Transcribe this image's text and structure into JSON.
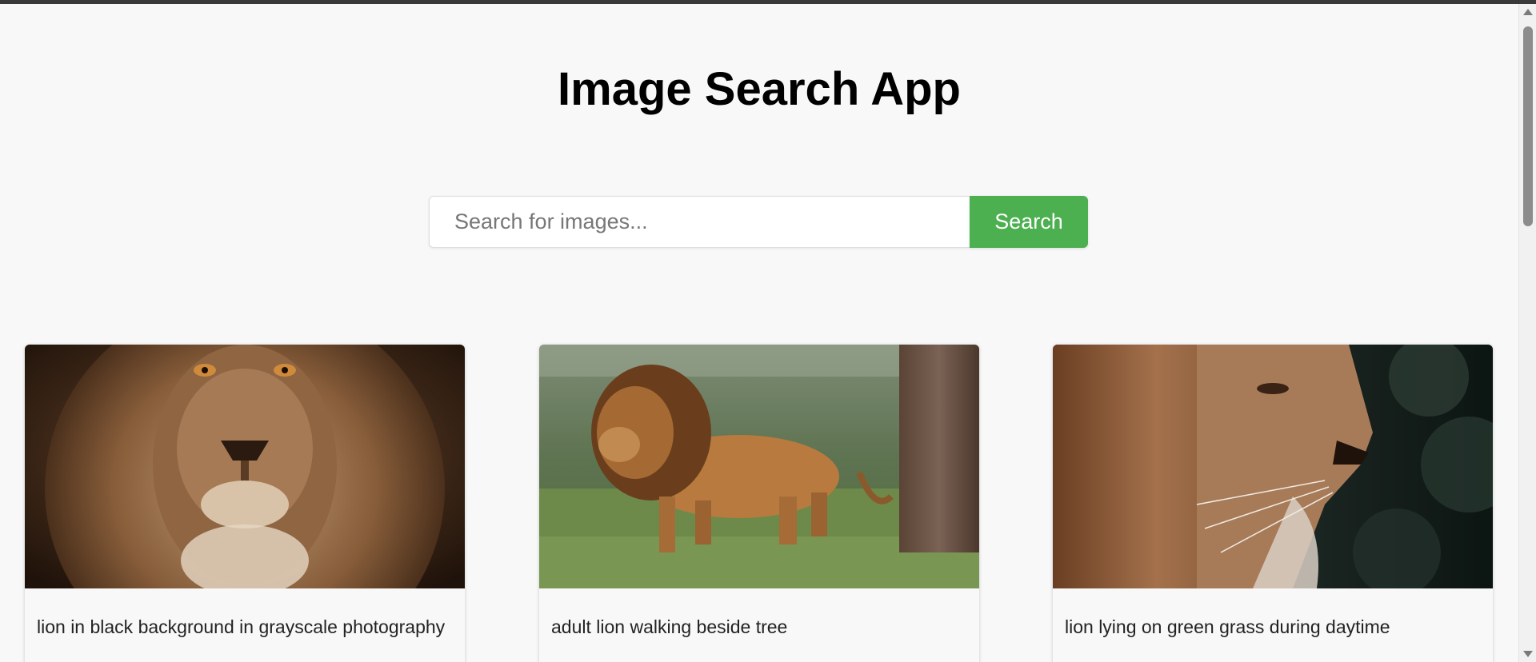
{
  "app": {
    "title": "Image Search App"
  },
  "search": {
    "placeholder": "Search for images...",
    "value": "",
    "button_label": "Search",
    "button_color": "#4caf50"
  },
  "results": [
    {
      "caption": "lion in black background in grayscale photography",
      "image": "lion-portrait-sepia"
    },
    {
      "caption": "adult lion walking beside tree",
      "image": "lion-walking-grass"
    },
    {
      "caption": "lion lying on green grass during daytime",
      "image": "lion-profile-dark-leaves"
    }
  ]
}
